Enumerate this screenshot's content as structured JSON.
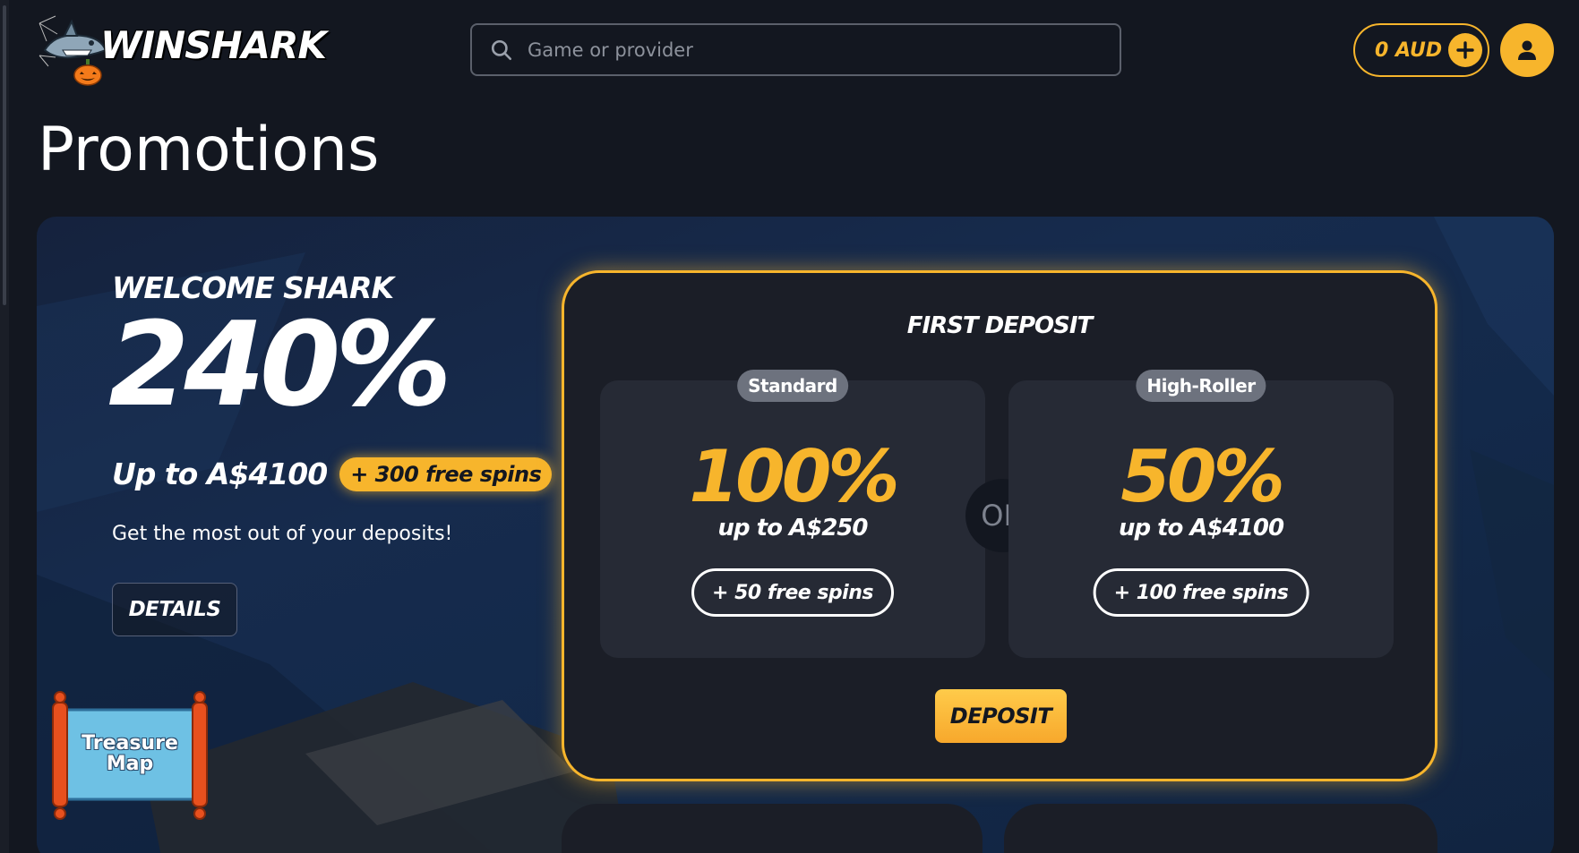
{
  "header": {
    "logo_text": "WINSHARK",
    "search_placeholder": "Game or provider",
    "balance": "0 AUD"
  },
  "page": {
    "title": "Promotions"
  },
  "welcome": {
    "title": "WELCOME SHARK",
    "percent": "240%",
    "upto": "Up to A$4100",
    "spins_badge": "+ 300 free spins",
    "subtitle": "Get the most out of your deposits!",
    "details_label": "DETAILS"
  },
  "treasure_map": {
    "label_line1": "Treasure",
    "label_line2": "Map"
  },
  "first_deposit": {
    "title": "FIRST DEPOSIT",
    "or_label": "OR",
    "deposit_label": "DEPOSIT",
    "options": [
      {
        "label": "Standard",
        "percent": "100%",
        "upto": "up to A$250",
        "spins": "+ 50 free spins"
      },
      {
        "label": "High-Roller",
        "percent": "50%",
        "upto": "up to A$4100",
        "spins": "+ 100 free spins"
      }
    ]
  },
  "colors": {
    "accent": "#f7b52c",
    "background": "#131720",
    "card": "#1b1e27"
  }
}
